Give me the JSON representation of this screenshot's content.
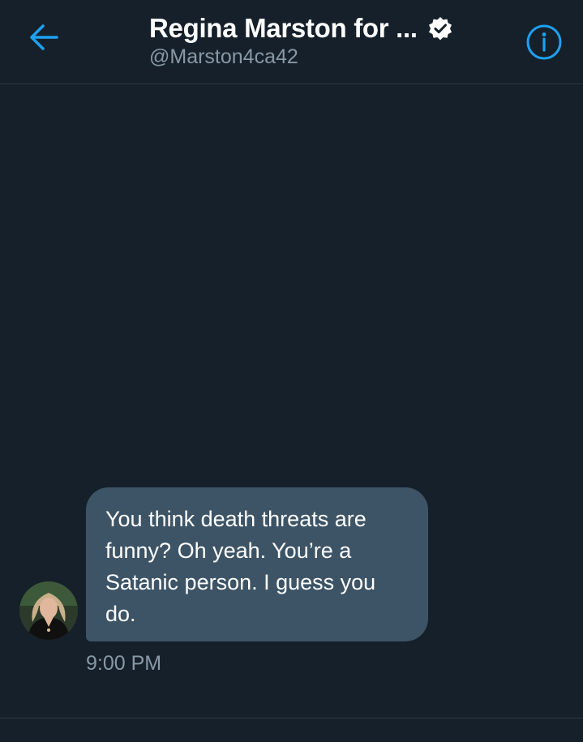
{
  "header": {
    "title": "Regina Marston for ...",
    "handle": "@Marston4ca42",
    "back_icon": "arrow-left-icon",
    "verified_icon": "verified-badge-icon",
    "info_icon": "info-icon"
  },
  "conversation": {
    "messages": [
      {
        "text": "You think death threats are funny? Oh yeah. You’re a Satanic person. I guess you do.",
        "timestamp": "9:00 PM"
      }
    ]
  },
  "colors": {
    "background": "#16202a",
    "accent": "#1da1f2",
    "bubble": "#3d5466",
    "secondary_text": "#8899a6",
    "divider": "#2c3a47"
  }
}
